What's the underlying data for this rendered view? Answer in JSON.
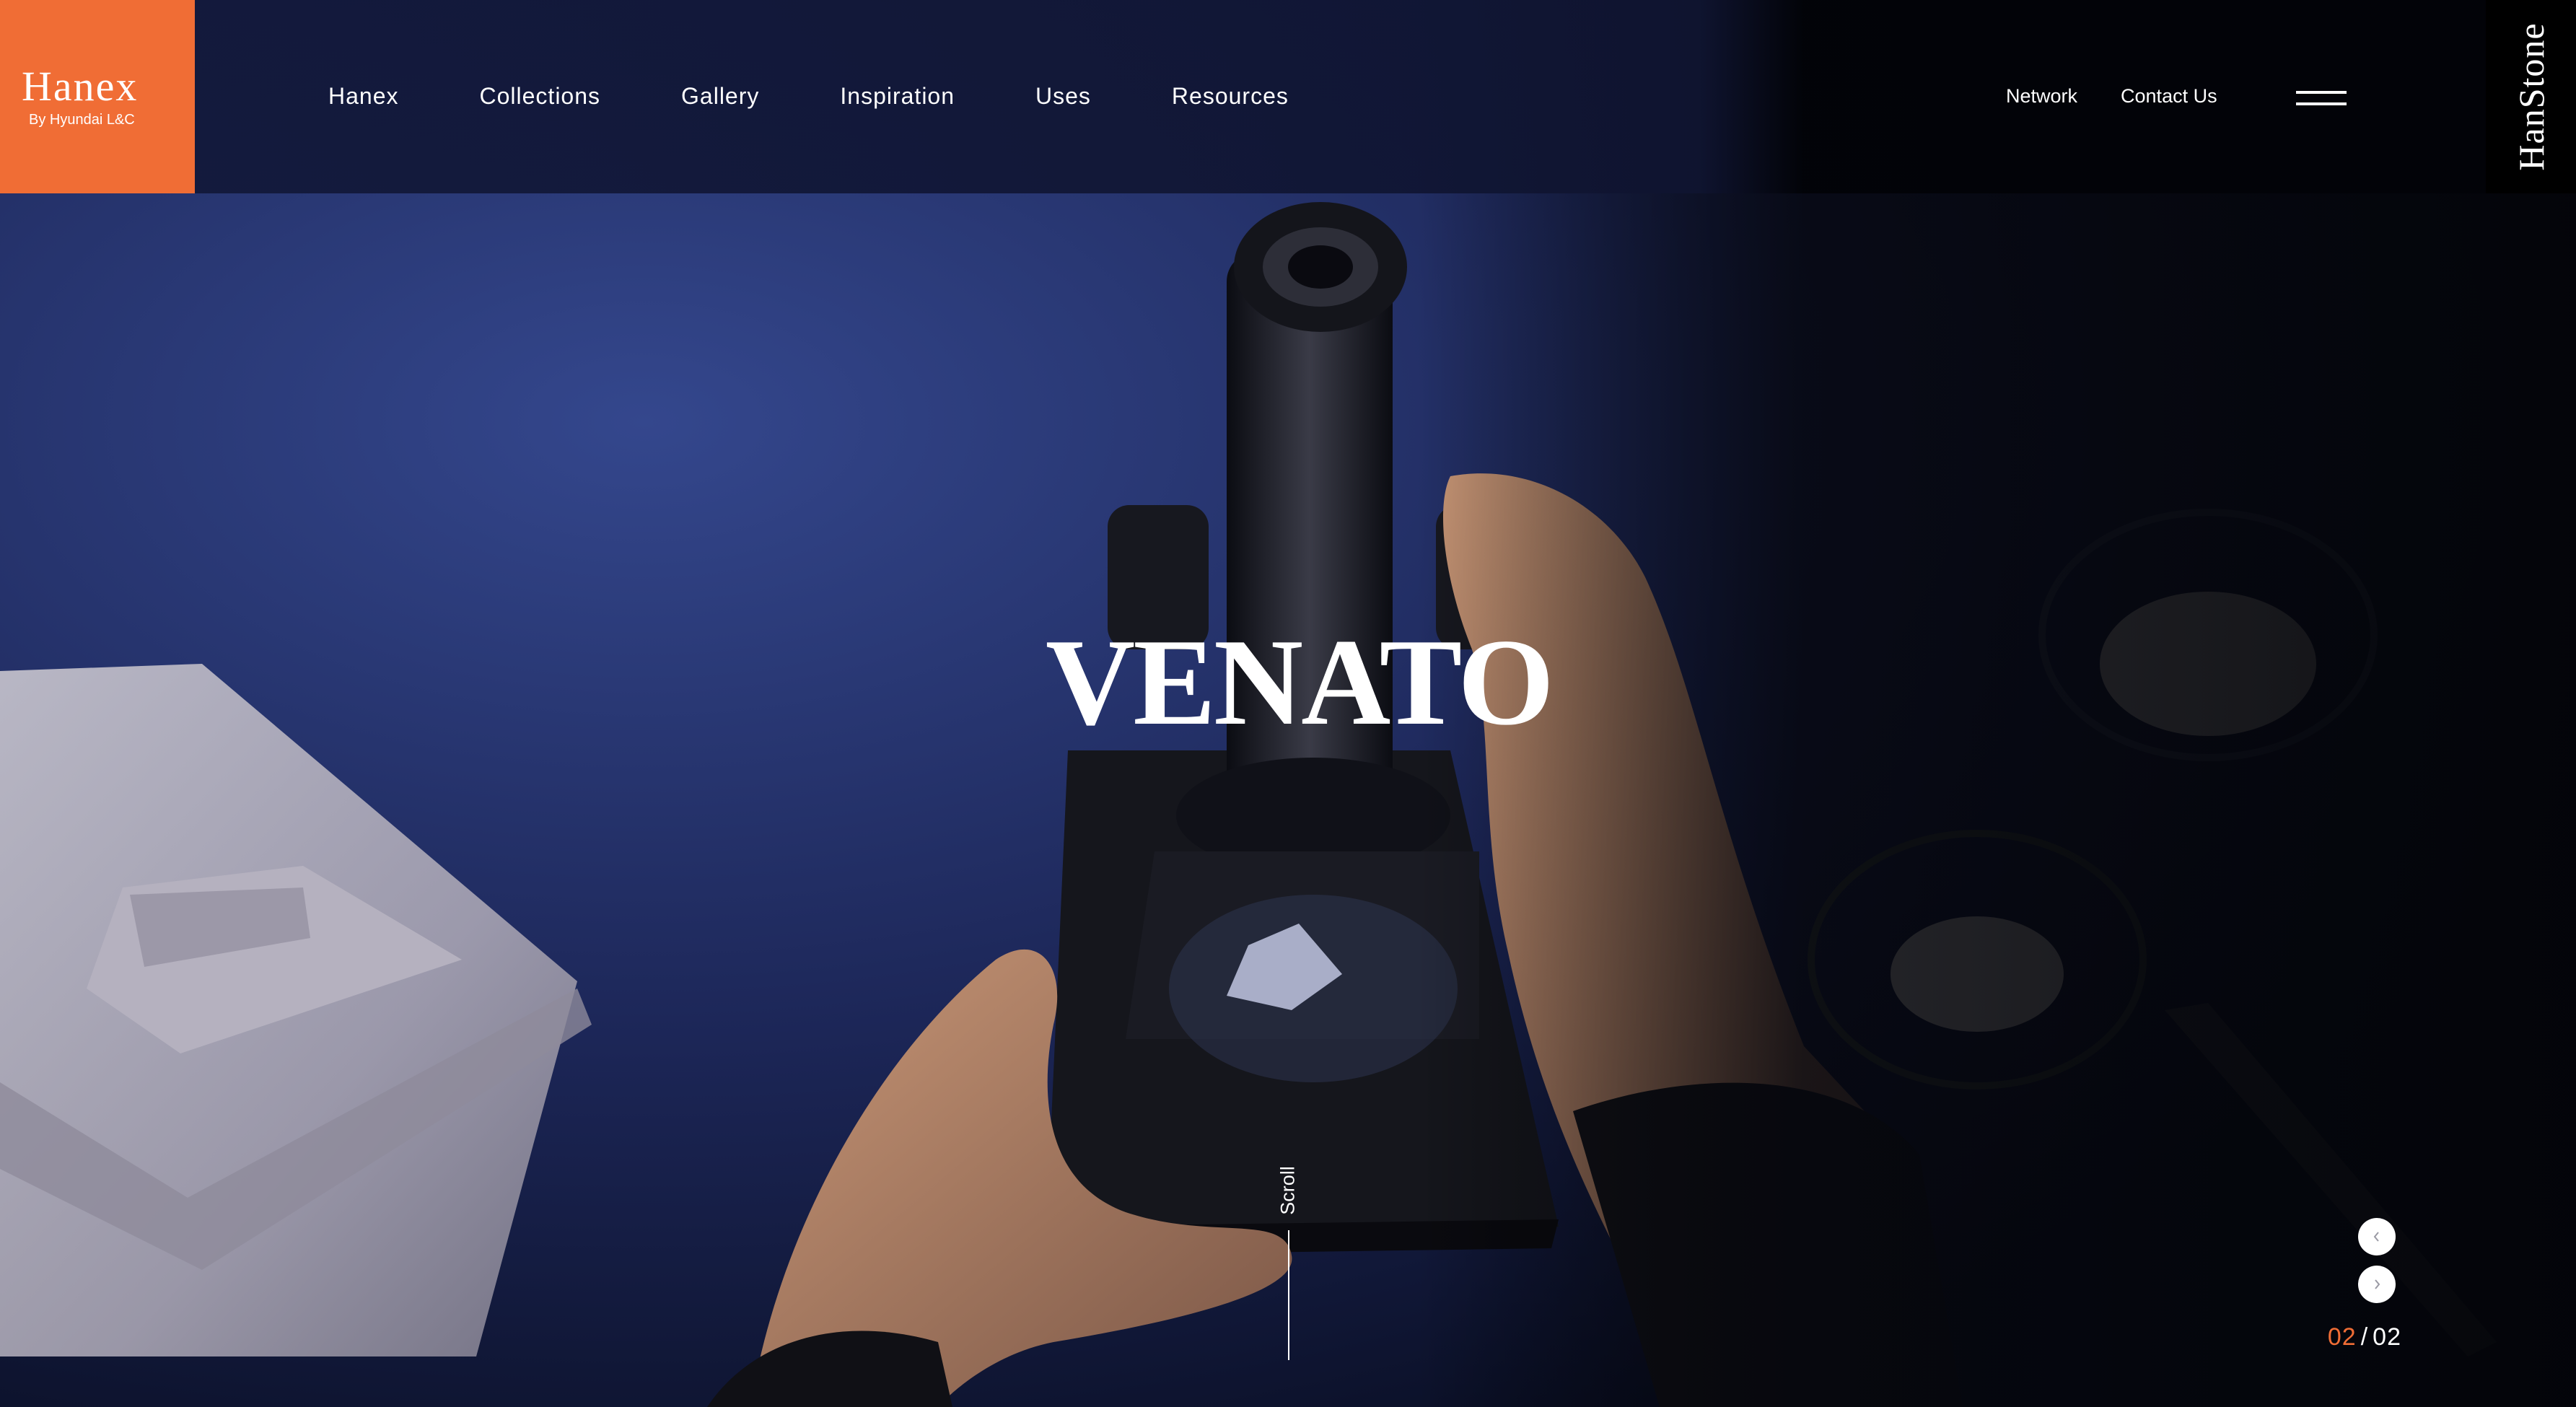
{
  "brand": {
    "logo_word": "Hanex",
    "logo_sub": "By Hyundai L&C",
    "accent_color": "#f06d35",
    "side_tab_label": "HanStone"
  },
  "main_nav": {
    "items": [
      {
        "label": "Hanex"
      },
      {
        "label": "Collections"
      },
      {
        "label": "Gallery"
      },
      {
        "label": "Inspiration"
      },
      {
        "label": "Uses"
      },
      {
        "label": "Resources"
      }
    ]
  },
  "util_nav": {
    "network_label": "Network",
    "contact_label": "Contact Us",
    "menu_icon": "hamburger-menu-icon"
  },
  "hero": {
    "title": "VENATO",
    "scroll_label": "Scroll"
  },
  "slider": {
    "prev_icon": "chevron-left-icon",
    "next_icon": "chevron-right-icon",
    "current": "02",
    "separator": "/",
    "total": "02"
  }
}
